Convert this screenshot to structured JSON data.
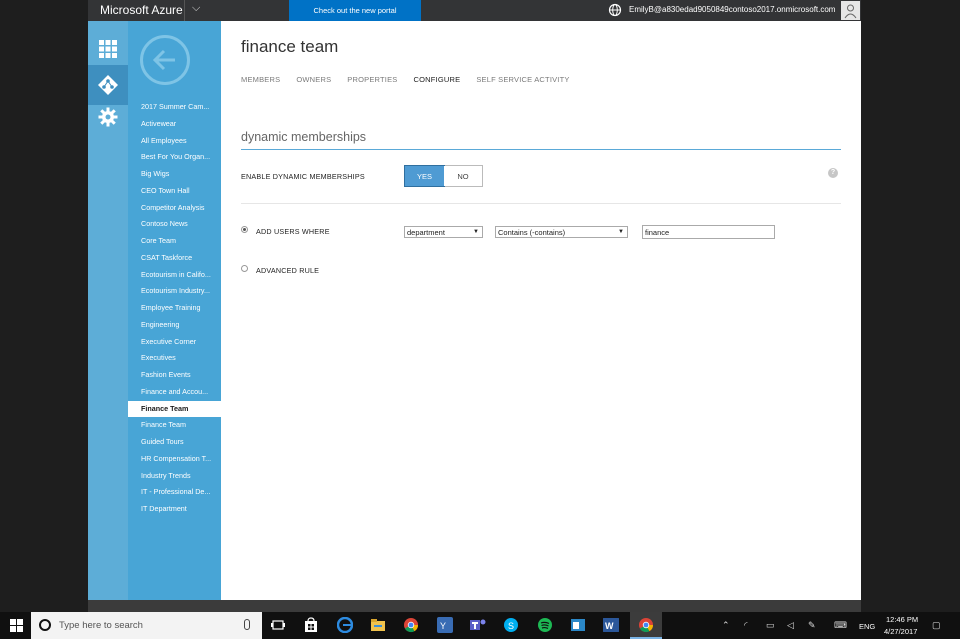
{
  "topbar": {
    "brand": "Microsoft Azure",
    "new_portal": "Check out the new portal",
    "user_email": "EmilyB@a830edad9050849contoso2017.onmicrosoft.com"
  },
  "sidebar": {
    "items": [
      {
        "label": "2017 Summer Cam..."
      },
      {
        "label": "Activewear"
      },
      {
        "label": "All Employees"
      },
      {
        "label": "Best For You Organ..."
      },
      {
        "label": "Big Wigs"
      },
      {
        "label": "CEO Town Hall"
      },
      {
        "label": "Competitor Analysis"
      },
      {
        "label": "Contoso News"
      },
      {
        "label": "Core Team"
      },
      {
        "label": "CSAT Taskforce"
      },
      {
        "label": "Ecotourism in Califo..."
      },
      {
        "label": "Ecotourism Industry..."
      },
      {
        "label": "Employee Training"
      },
      {
        "label": "Engineering"
      },
      {
        "label": "Executive Corner"
      },
      {
        "label": "Executives"
      },
      {
        "label": "Fashion Events"
      },
      {
        "label": "Finance and Accou..."
      },
      {
        "label": "Finance Team"
      },
      {
        "label": "Finance Team"
      },
      {
        "label": "Guided Tours"
      },
      {
        "label": "HR Compensation T..."
      },
      {
        "label": "Industry Trends"
      },
      {
        "label": "IT - Professional De..."
      },
      {
        "label": "IT Department"
      }
    ],
    "selected_index": 18
  },
  "main": {
    "title": "finance team",
    "tabs": [
      {
        "label": "MEMBERS"
      },
      {
        "label": "OWNERS"
      },
      {
        "label": "PROPERTIES"
      },
      {
        "label": "CONFIGURE"
      },
      {
        "label": "SELF SERVICE ACTIVITY"
      }
    ],
    "active_tab": 3,
    "section_title": "dynamic memberships",
    "enable_label": "ENABLE DYNAMIC MEMBERSHIPS",
    "toggle_yes": "YES",
    "toggle_no": "NO",
    "help_glyph": "?",
    "add_users_label": "ADD USERS WHERE",
    "attribute_select": "department",
    "operator_select": "Contains (-contains)",
    "value_input": "finance",
    "advanced_label": "ADVANCED RULE"
  },
  "taskbar": {
    "search_placeholder": "Type here to search",
    "language": "ENG",
    "time": "12:46 PM",
    "date": "4/27/2017"
  },
  "colors": {
    "accent_blue": "#0072c6",
    "sidebar_blue": "#48a5d6",
    "iconbar_blue": "#5dadd7",
    "toggle_selected": "#4f9bd3"
  }
}
